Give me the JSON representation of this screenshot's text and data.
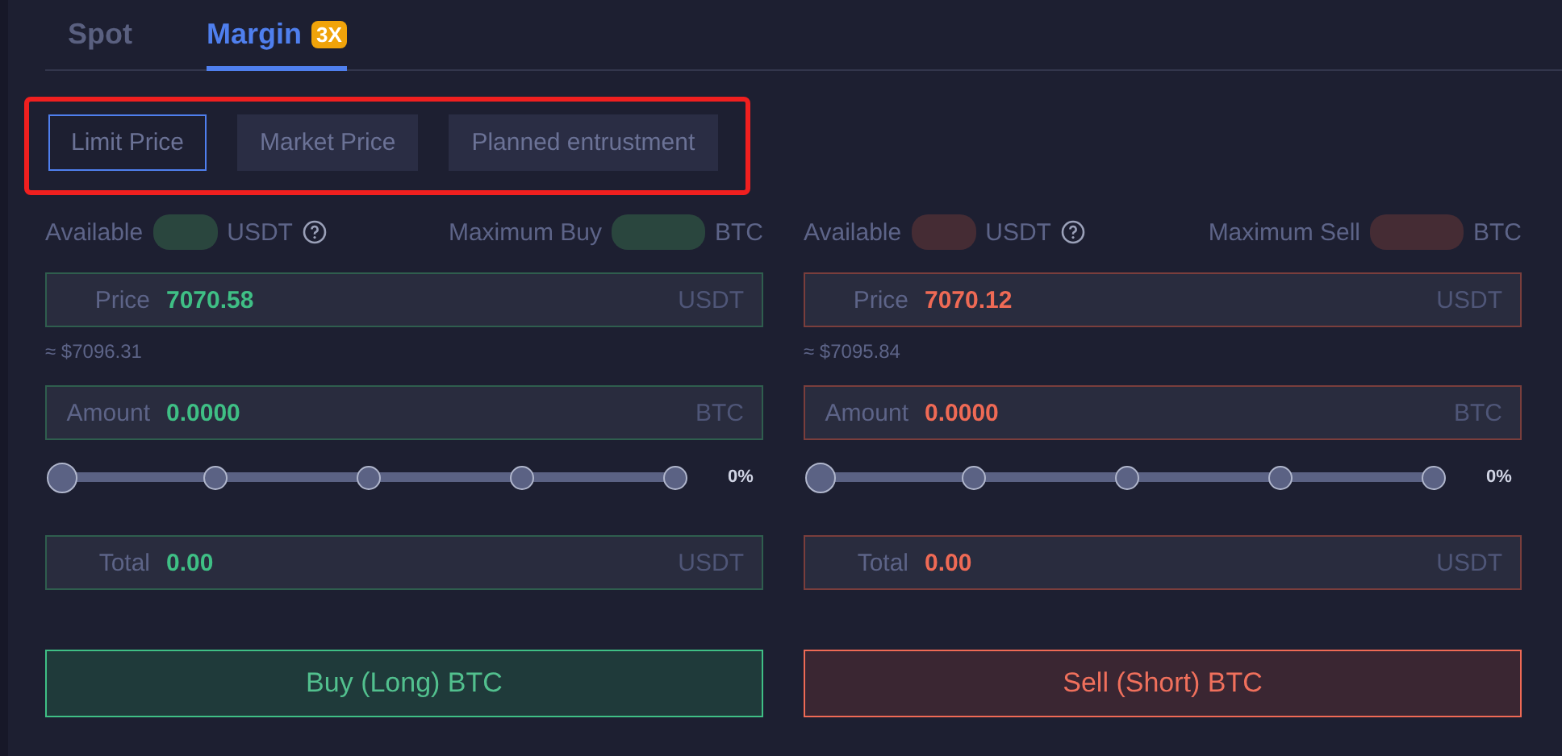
{
  "tabs": [
    {
      "label": "Spot",
      "selected": false
    },
    {
      "label": "Margin",
      "selected": true,
      "badge": "3X"
    }
  ],
  "order_types": [
    {
      "label": "Limit Price",
      "selected": true
    },
    {
      "label": "Market Price",
      "selected": false
    },
    {
      "label": "Planned entrustment",
      "selected": false
    }
  ],
  "panels": [
    {
      "kind": "buy",
      "available_label": "Available",
      "available_unit": "USDT",
      "max_label": "Maximum Buy",
      "max_unit": "BTC",
      "price": {
        "label": "Price",
        "value": "7070.58",
        "unit": "USDT"
      },
      "approx": "≈ $7096.31",
      "amount": {
        "label": "Amount",
        "value": "0.0000",
        "unit": "BTC"
      },
      "slider": {
        "level": 0,
        "reading": "0%"
      },
      "total": {
        "label": "Total",
        "value": "0.00",
        "unit": "USDT"
      },
      "button": "Buy (Long) BTC"
    },
    {
      "kind": "sell",
      "available_label": "Available",
      "available_unit": "USDT",
      "max_label": "Maximum Sell",
      "max_unit": "BTC",
      "price": {
        "label": "Price",
        "value": "7070.12",
        "unit": "USDT"
      },
      "approx": "≈ $7095.84",
      "amount": {
        "label": "Amount",
        "value": "0.0000",
        "unit": "BTC"
      },
      "slider": {
        "level": 0,
        "reading": "0%"
      },
      "total": {
        "label": "Total",
        "value": "0.00",
        "unit": "USDT"
      },
      "button": "Sell (Short) BTC"
    }
  ]
}
